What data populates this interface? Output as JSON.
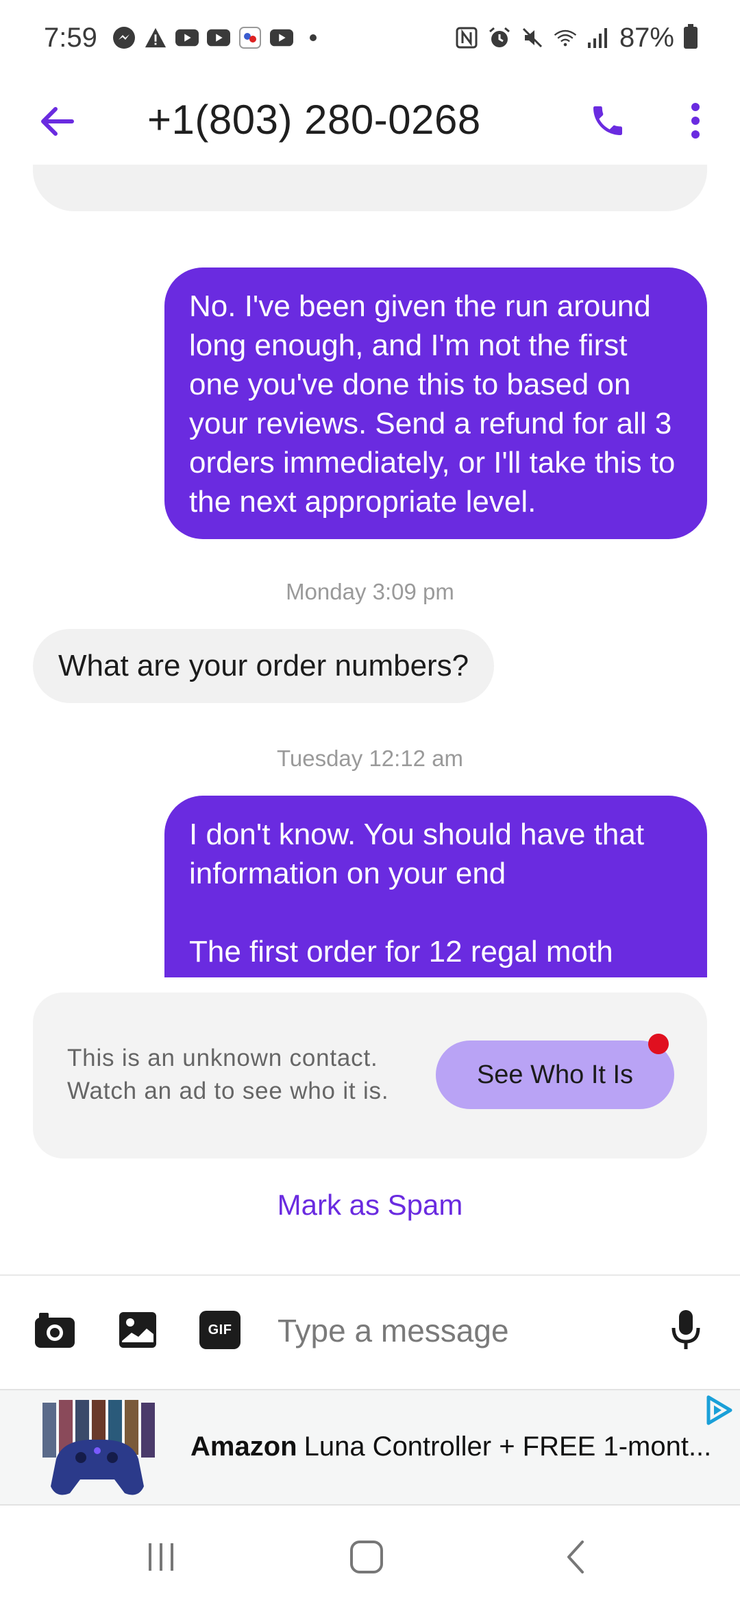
{
  "status_bar": {
    "time": "7:59",
    "battery": "87%",
    "left_icons": [
      "messenger-icon",
      "alert-icon",
      "youtube-icon",
      "youtube-icon",
      "app-icon",
      "youtube-icon",
      "dot-icon"
    ],
    "right_icons": [
      "nfc-icon",
      "alarm-icon",
      "mute-icon",
      "wifi-icon",
      "signal-icon",
      "battery-icon"
    ]
  },
  "header": {
    "title": "+1(803) 280-0268",
    "back_icon": "arrow-left-icon",
    "call_icon": "phone-icon",
    "more_icon": "more-vert-icon"
  },
  "conversation": {
    "messages": [
      {
        "direction": "outgoing",
        "text": "No. I've been given the run around long enough, and I'm not the first one you've done this to based on your reviews. Send a refund for all 3 orders immediately, or I'll take this to the next appropriate level."
      },
      {
        "timestamp": "Monday 3:09 pm"
      },
      {
        "direction": "incoming",
        "text": "What are your order numbers?"
      },
      {
        "timestamp": "Tuesday 12:12 am"
      },
      {
        "direction": "outgoing",
        "text_line_1": "I don't know. You should have that information on your end",
        "text_line_2": "The first order for 12 regal moth"
      }
    ]
  },
  "unknown_contact": {
    "message": "This is an unknown contact. Watch an ad to see who it is.",
    "button_label": "See Who It Is",
    "spam_link": "Mark as Spam"
  },
  "compose": {
    "placeholder": "Type a message",
    "gif_label": "GIF",
    "icons": [
      "camera-icon",
      "image-icon",
      "gif-icon",
      "mic-icon"
    ]
  },
  "ad": {
    "brand": "Amazon",
    "text": "Luna Controller + FREE 1-mont...",
    "choice_icon": "adchoices-icon"
  },
  "colors": {
    "accent": "#6a2be0",
    "outgoing_bubble": "#6a2be0",
    "incoming_bubble": "#f1f1f1",
    "see_button": "#b9a3f5",
    "notification_dot": "#e0101f"
  }
}
